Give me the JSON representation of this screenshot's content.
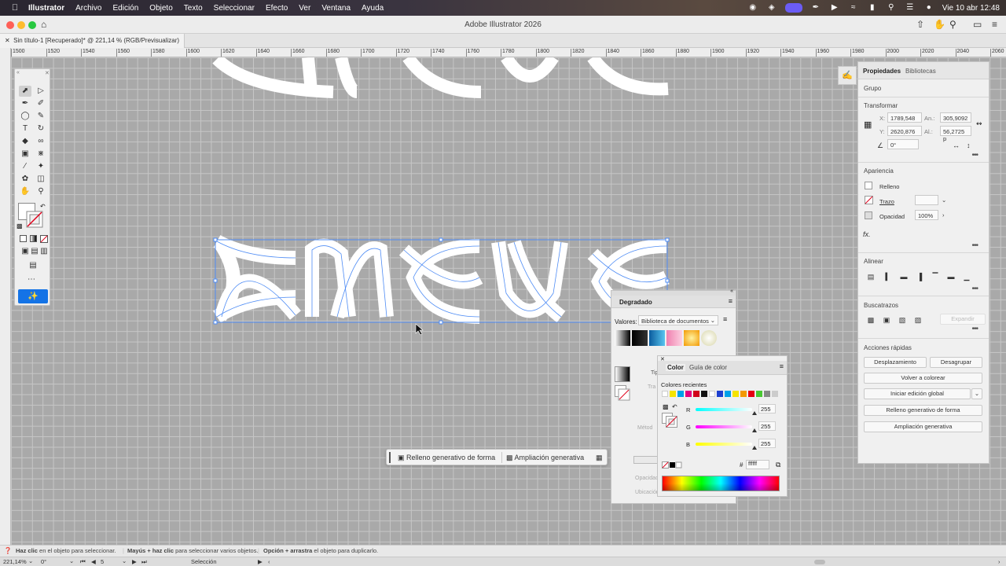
{
  "menubar": {
    "app": "Illustrator",
    "items": [
      "Archivo",
      "Edición",
      "Objeto",
      "Texto",
      "Seleccionar",
      "Efecto",
      "Ver",
      "Ventana",
      "Ayuda"
    ],
    "clock": "Vie 10 abr  12:48"
  },
  "window": {
    "title": "Adobe Illustrator 2026",
    "doc_tab": "Sin título-1 [Recuperado]* @ 221,14 % (RGB/Previsualizar)"
  },
  "ruler": {
    "ticks": [
      "1500",
      "1520",
      "1540",
      "1560",
      "1580",
      "1600",
      "1620",
      "1640",
      "1660",
      "1680",
      "1700",
      "1720",
      "1740",
      "1760",
      "1780",
      "1800",
      "1820",
      "1840",
      "1860",
      "1880",
      "1900",
      "1920",
      "1940",
      "1960",
      "1980",
      "2000",
      "2020",
      "2040",
      "2060"
    ]
  },
  "properties": {
    "tab1": "Propiedades",
    "tab2": "Bibliotecas",
    "object_type": "Grupo",
    "transform_title": "Transformar",
    "x_label": "X:",
    "x": "1789,548",
    "y_label": "Y:",
    "y": "2620,876",
    "w_label": "An.:",
    "w": "305,9092",
    "h_label": "Al.:",
    "h": "56,2725 p",
    "angle": "0°",
    "appearance_title": "Apariencia",
    "fill_label": "Relleno",
    "stroke_label": "Trazo",
    "opacity_label": "Opacidad",
    "opacity": "100%",
    "fx": "fx.",
    "align_title": "Alinear",
    "pathfinder_title": "Buscatrazos",
    "expand": "Expandir",
    "quick_title": "Acciones rápidas",
    "q_offset": "Desplazamiento",
    "q_ungroup": "Desagrupar",
    "q_recolor": "Volver a colorear",
    "q_global": "Iniciar edición global",
    "q_genfill": "Relleno generativo de forma",
    "q_genexpand": "Ampliación generativa"
  },
  "gradient": {
    "title": "Degradado",
    "values_label": "Valores:",
    "library": "Biblioteca de documentos",
    "dim_type": "Tip",
    "dim_trazo": "Tra",
    "dim_method": "Métod",
    "dim_opacity": "Opacidad",
    "dim_location": "Ubicación"
  },
  "color": {
    "tab1": "Color",
    "tab2": "Guía de color",
    "recent_label": "Colores recientes",
    "r_label": "R",
    "r": "255",
    "g_label": "G",
    "g": "255",
    "b_label": "B",
    "b": "255",
    "hex_label": "#",
    "hex": "ffffff",
    "recent": [
      "#ffffff",
      "#f5e400",
      "#00a0e9",
      "#e4007f",
      "#d0021b",
      "#111111",
      "#ffffff",
      "#1d3fcf",
      "#00a0e9",
      "#f5e400",
      "#f39800",
      "#e60012",
      "#49c832",
      "#888888",
      "#cccccc"
    ]
  },
  "taskbar": {
    "btn1": "Relleno generativo de forma",
    "btn2": "Ampliación generativa"
  },
  "status": {
    "hint1_bold": "Haz clic",
    "hint1": "en el objeto para seleccionar.",
    "hint2_bold": "Mayús + haz clic",
    "hint2": "para seleccionar varios objetos.",
    "hint3_bold": "Opción + arrastra",
    "hint3": "el objeto para duplicarlo.",
    "zoom": "221,14%",
    "rotation": "0°",
    "artboard": "5",
    "mode": "Selección"
  }
}
